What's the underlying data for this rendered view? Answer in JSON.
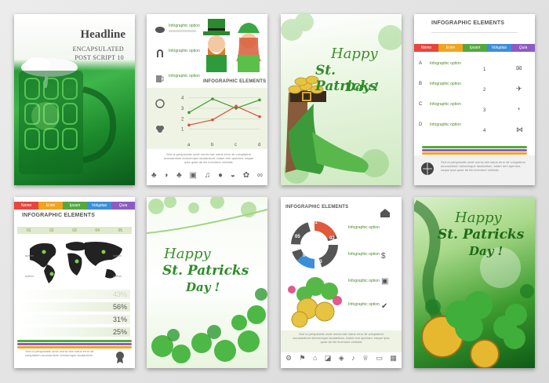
{
  "card1": {
    "headline": "Headline",
    "sub1": "ENCAPSULATED",
    "sub2": "POST SCRIPT 10"
  },
  "card2": {
    "option_label": "Infographic option",
    "title": "INFOGRAPHIC ELEMENTS",
    "y_ticks": [
      "1",
      "2",
      "3",
      "4"
    ],
    "x_ticks": [
      "a",
      "b",
      "c",
      "d"
    ],
    "chart_data": {
      "type": "line",
      "categories": [
        "a",
        "b",
        "c",
        "d"
      ],
      "series": [
        {
          "values": [
            2.6,
            3.9,
            3.0,
            3.8
          ],
          "color": "#3f9a2a"
        },
        {
          "values": [
            1.4,
            1.9,
            3.2,
            2.2
          ],
          "color": "#d8513d"
        }
      ],
      "ylim": [
        0,
        4.5
      ]
    },
    "footer_text": "Sed ut perspiciatis unde omnis iste natus error sit voluptatem accusantium doloremque laudantium, totam rem aperiam, eaque ipsa quae ab illo inventore veritatis"
  },
  "card3": {
    "line1": "Happy",
    "line2": "St. Patricks",
    "line3": "Day !"
  },
  "card4": {
    "title": "INFOGRAPHIC ELEMENTS",
    "tabs": [
      {
        "label": "Nemo",
        "color": "#e8453c"
      },
      {
        "label": "Enim",
        "color": "#f1a41f"
      },
      {
        "label": "Ipsam",
        "color": "#53a93f"
      },
      {
        "label": "Voluptas",
        "color": "#3b8fd9"
      },
      {
        "label": "Quia",
        "color": "#8e5cc1"
      }
    ],
    "rows": [
      {
        "letter": "A",
        "num": "1"
      },
      {
        "letter": "B",
        "num": "2"
      },
      {
        "letter": "C",
        "num": "3"
      },
      {
        "letter": "D",
        "num": "4"
      }
    ],
    "option_label": "Infographic option",
    "footer_text": "Sed ut perspiciatis unde omnis iste natus error sit voluptatem accusantium doloremque laudantium, totam rem aperiam, eaque ipsa quae ab illo inventore veritatis"
  },
  "card5": {
    "tabs": [
      {
        "label": "Nemo",
        "color": "#e8453c"
      },
      {
        "label": "Enim",
        "color": "#f1a41f"
      },
      {
        "label": "Ipsam",
        "color": "#53a93f"
      },
      {
        "label": "Voluptas",
        "color": "#3b8fd9"
      },
      {
        "label": "Quia",
        "color": "#8e5cc1"
      }
    ],
    "title": "INFOGRAPHIC ELEMENTS",
    "steps": [
      "01",
      "02",
      "03",
      "04",
      "05"
    ],
    "map_option": "option",
    "percents": [
      "43%",
      "56%",
      "31%",
      "25%"
    ],
    "footer_text": "Sed ut perspiciatis unde omnis iste natus error sit voluptatem accusantium doloremque laudantium"
  },
  "card6": {
    "line1": "Happy",
    "line2": "St. Patricks",
    "line3": "Day !"
  },
  "card7": {
    "title": "INFOGRAPHIC ELEMENTS",
    "ring_labels": [
      "01",
      "02",
      "03",
      "04",
      "05"
    ],
    "option_label": "Infographic option",
    "footer_text": "Sed ut perspiciatis unde omnis iste natus error sit voluptatem accusantium doloremque laudantium, totam rem aperiam, eaque ipsa quae ab illo inventore veritatis"
  },
  "card8": {
    "line1": "Happy",
    "line2": "St. Patricks",
    "line3": "Day !"
  }
}
